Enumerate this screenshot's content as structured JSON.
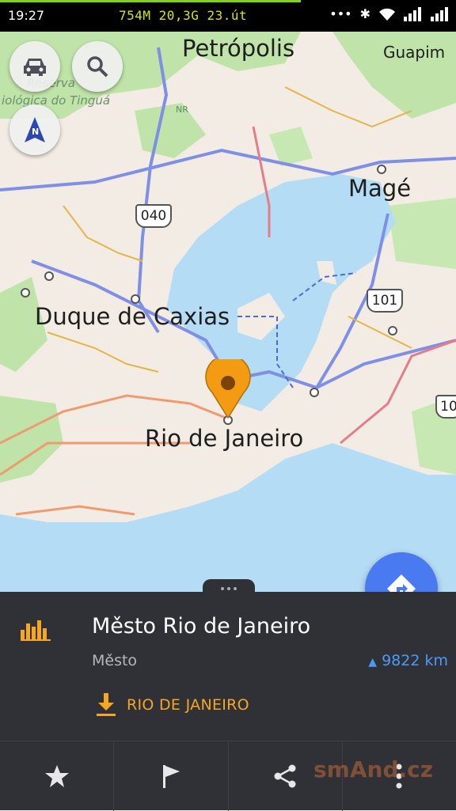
{
  "status_bar": {
    "time": "19:27",
    "center_text": "754M  20,3G 23.út",
    "icons": [
      "more-icon",
      "bluetooth-icon",
      "wifi-icon",
      "signal-icon",
      "signal-icon"
    ]
  },
  "map": {
    "labels": {
      "petropolis": "Petrópolis",
      "guapimirim": "Guapim",
      "reserva_line1": "Reserva",
      "reserva_line2": "iológica do Tinguá",
      "mage": "Magé",
      "duque": "Duque de Caxias",
      "rio": "Rio de Janeiro",
      "nr": "NR"
    },
    "shields": {
      "r040": "040",
      "r101": "101",
      "r10": "10"
    },
    "compass_letter": "N"
  },
  "place": {
    "name": "Město Rio de Janeiro",
    "type": "Město",
    "distance": "9822 km",
    "download_label": "RIO DE JANEIRO"
  },
  "watermark": "smAnd.cz",
  "colors": {
    "accent": "#f5a623",
    "route_button": "#4a7af0",
    "distance": "#4d9af5",
    "water": "#b5dcf5",
    "land": "#f3ece4",
    "forest": "#bfe3a8"
  }
}
